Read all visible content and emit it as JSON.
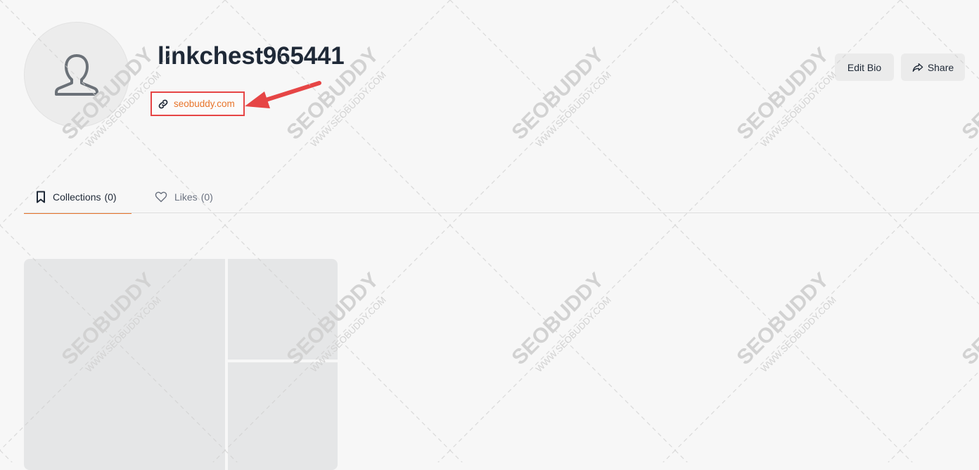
{
  "profile": {
    "username": "linkchest965441",
    "website": "seobuddy.com"
  },
  "actions": {
    "edit_bio": "Edit Bio",
    "share": "Share"
  },
  "tabs": [
    {
      "label": "Collections",
      "count": "(0)",
      "active": true,
      "icon": "bookmark-icon"
    },
    {
      "label": "Likes",
      "count": "(0)",
      "active": false,
      "icon": "heart-icon"
    }
  ],
  "watermark": {
    "brand": "SEOBUDDY",
    "url": "WWW.SEOBUDDY.COM"
  },
  "colors": {
    "accent": "#e8742a",
    "highlight_box": "#e64545",
    "background": "#f7f7f7"
  }
}
